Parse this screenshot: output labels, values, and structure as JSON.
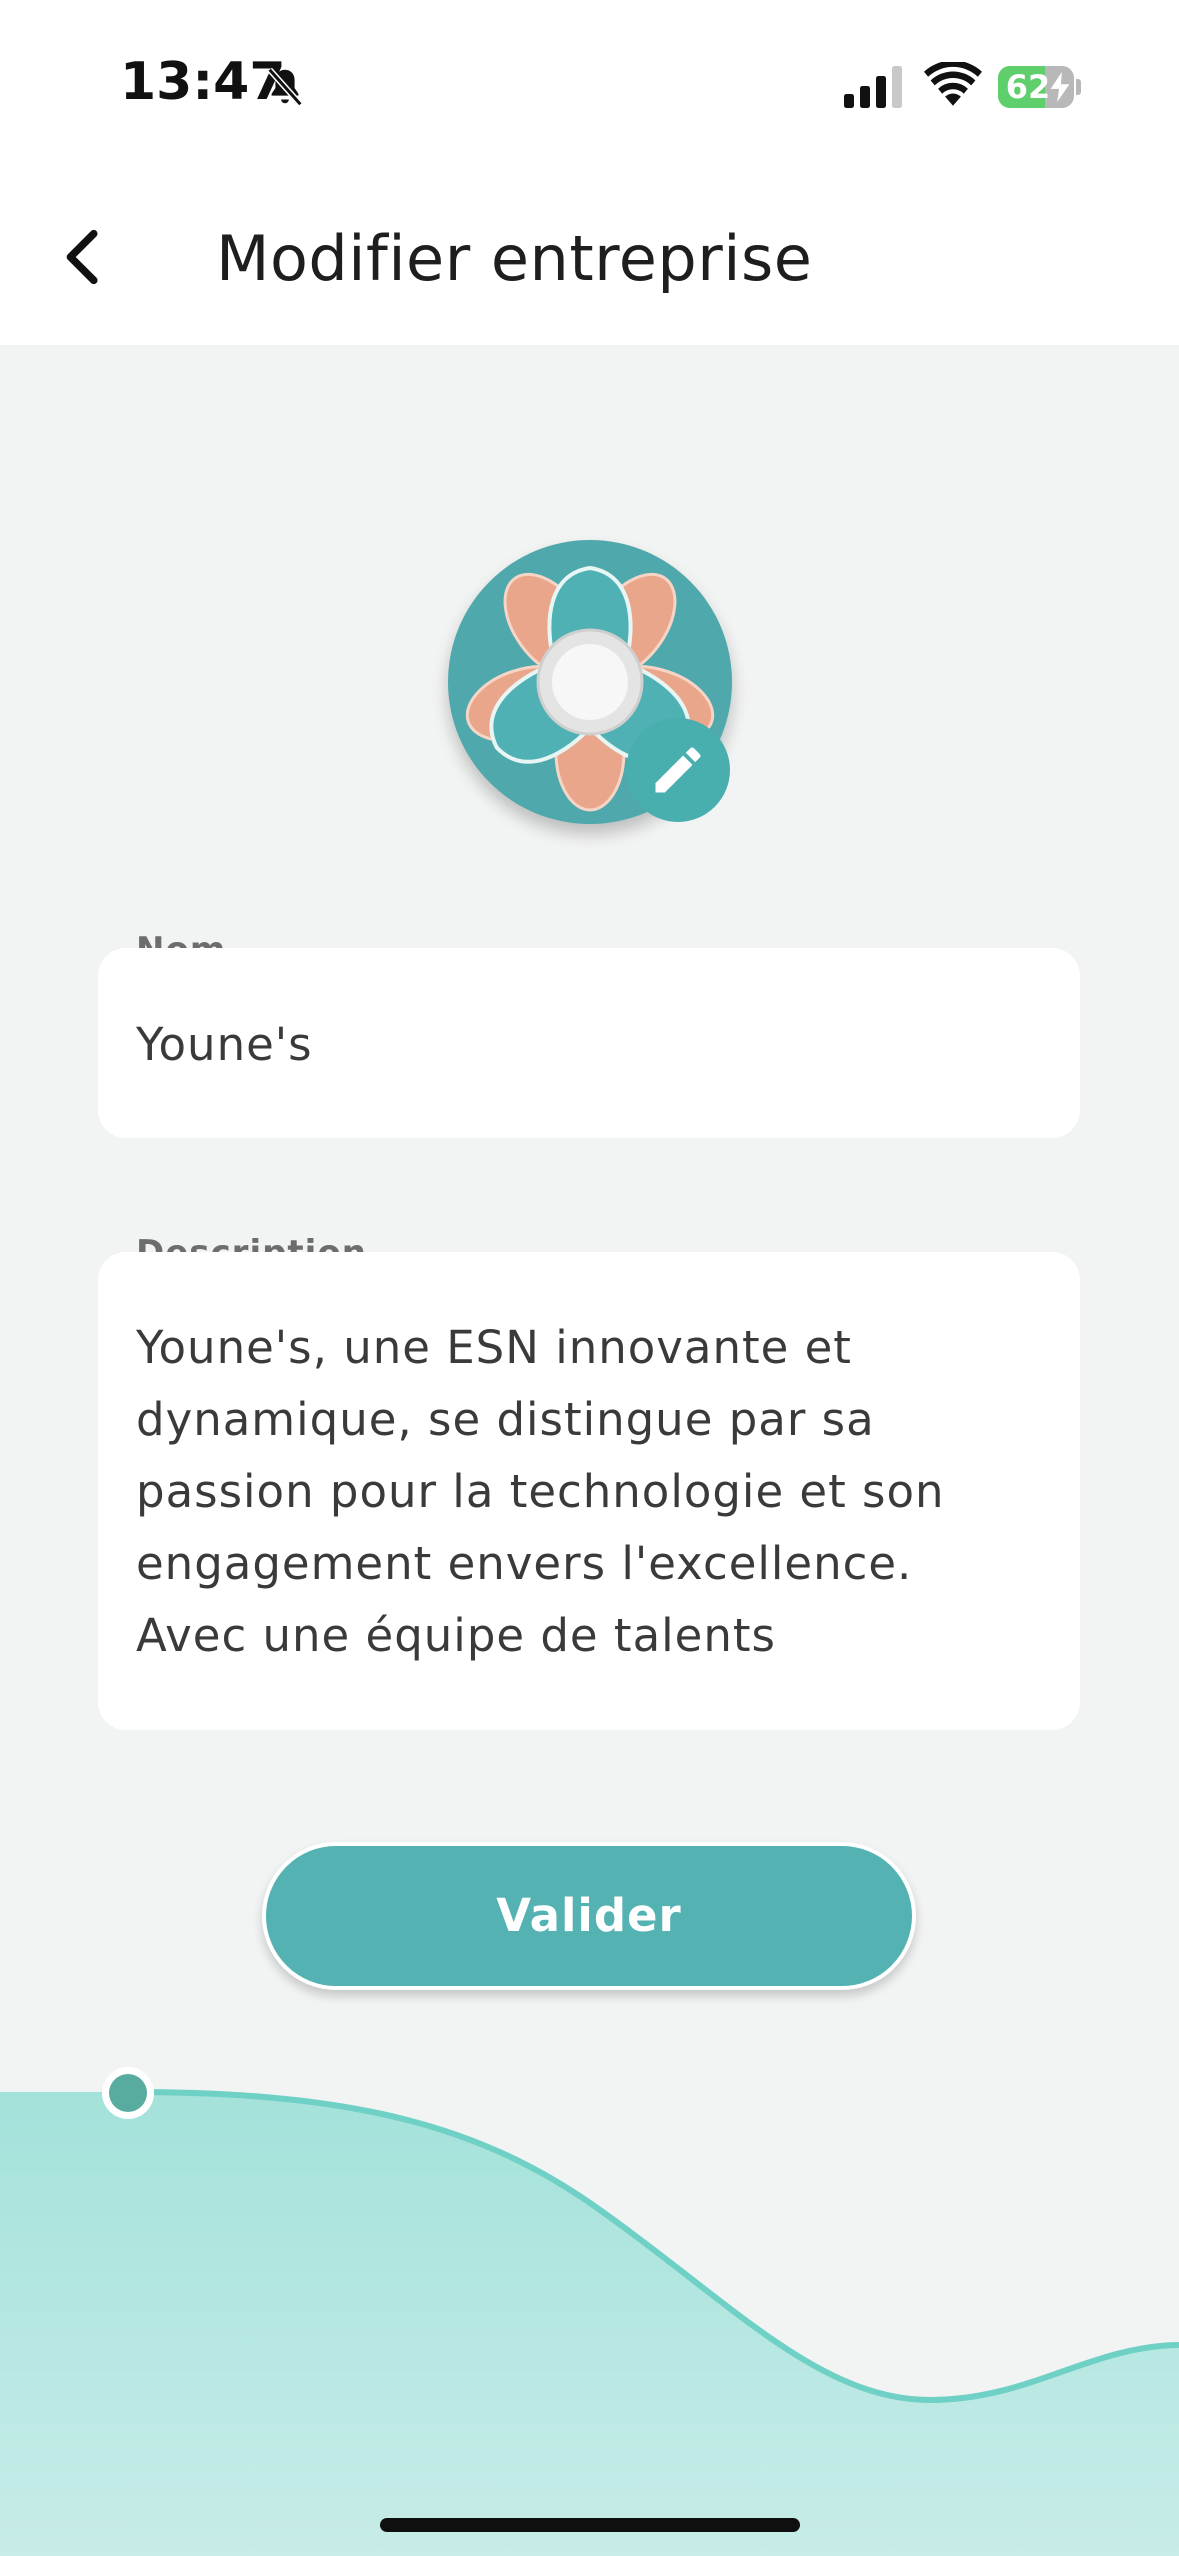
{
  "status_bar": {
    "time": "13:47",
    "battery_level": 62,
    "battery_label": "62",
    "icons": [
      "bell-slash-icon",
      "cellular-signal-icon",
      "wifi-icon",
      "battery-charging-icon"
    ]
  },
  "header": {
    "back_icon": "chevron-left-icon",
    "title": "Modifier entreprise"
  },
  "avatar": {
    "edit_icon": "pencil-icon"
  },
  "form": {
    "name_label": "Nom",
    "name_value": "Youne's",
    "description_label": "Description",
    "description_value": "Youne's, une ESN innovante et\ndynamique, se distingue par sa\npassion pour la technologie et son\nengagement envers l'excellence.\nAvec une équipe de talents"
  },
  "actions": {
    "submit_label": "Valider"
  },
  "colors": {
    "accent": "#54b2b2",
    "background": "#f2f3f3",
    "wave_light": "#a6e3dc",
    "avatar_petal": "#e9a68a"
  }
}
